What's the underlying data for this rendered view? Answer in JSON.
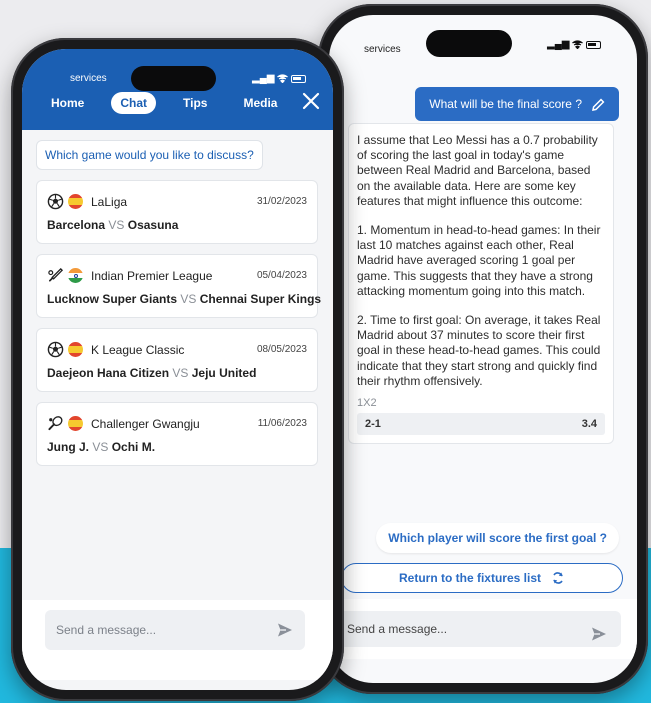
{
  "back_phone": {
    "status": {
      "carrier": "services"
    },
    "user_message": {
      "text": "What will be the final score ?",
      "icon": "pencil-icon"
    },
    "bot_message": {
      "paragraphs": [
        "I assume that Leo Messi has a 0.7 probability of scoring the last goal in today's game between Real Madrid and Barcelona, based on the available data. Here are some key features that might influence this outcome:",
        "1. Momentum in head-to-head games: In their last 10 matches against each other, Real Madrid have averaged scoring 1 goal per game. This suggests that they have a strong attacking momentum going into this match.",
        "2. Time to first goal: On average, it takes Real Madrid about 37 minutes to score their first goal in these head-to-head games. This could indicate that they start strong and quickly find their rhythm offensively."
      ],
      "odds_label": "1X2",
      "odds": {
        "result": "2-1",
        "value": "3.4"
      }
    },
    "suggestion": "Which player will score the first goal ?",
    "return_button": {
      "label": "Return to the fixtures list",
      "icon": "refresh-icon"
    },
    "input": {
      "placeholder": "Send a message..."
    }
  },
  "front_phone": {
    "status": {
      "carrier": "services"
    },
    "nav": {
      "items": [
        {
          "label": "Home"
        },
        {
          "label": "Chat"
        },
        {
          "label": "Tips"
        },
        {
          "label": "Media"
        }
      ],
      "active": "Chat"
    },
    "question": "Which game would you like to discuss?",
    "fixtures": [
      {
        "sport_icon": "soccer-ball-icon",
        "flag": "spain-flag",
        "league": "LaLiga",
        "date": "31/02/2023",
        "home": "Barcelona",
        "vs": "VS",
        "away": "Osasuna"
      },
      {
        "sport_icon": "cricket-icon",
        "flag": "india-flag",
        "league": "Indian Premier League",
        "date": "05/04/2023",
        "home": "Lucknow Super Giants",
        "vs": "VS",
        "away": "Chennai Super Kings"
      },
      {
        "sport_icon": "soccer-ball-icon",
        "flag": "spain-flag",
        "league": "K League Classic",
        "date": "08/05/2023",
        "home": "Daejeon Hana Citizen",
        "vs": "VS",
        "away": "Jeju United"
      },
      {
        "sport_icon": "tennis-icon",
        "flag": "spain-flag",
        "league": "Challenger Gwangju",
        "date": "11/06/2023",
        "home": "Jung J.",
        "vs": "VS",
        "away": "Ochi M."
      }
    ],
    "input": {
      "placeholder": "Send a message..."
    }
  },
  "colors": {
    "brand_blue": "#1b5fb3",
    "accent_blue": "#2b6cc4",
    "background_cyan": "#21b8de"
  }
}
